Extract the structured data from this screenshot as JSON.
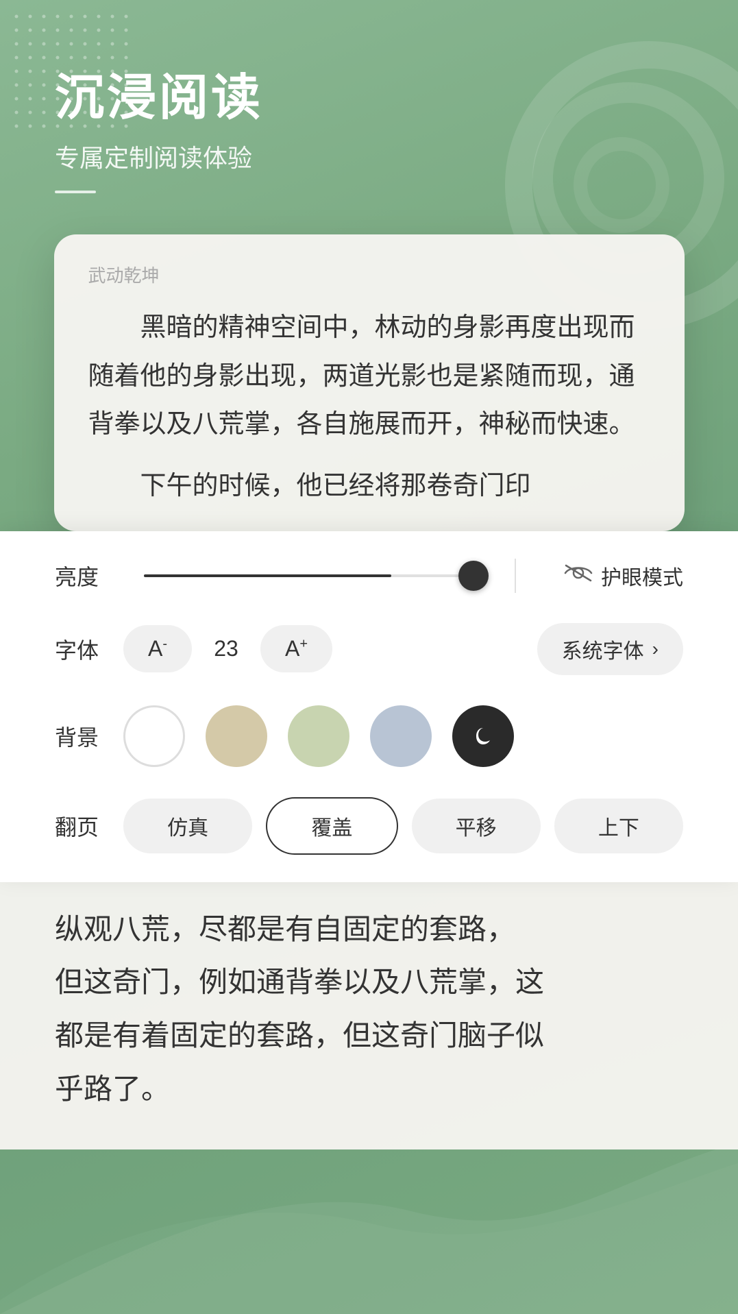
{
  "hero": {
    "title": "沉浸阅读",
    "subtitle": "专属定制阅读体验"
  },
  "reading": {
    "book_title": "武动乾坤",
    "paragraph1": "黑暗的精神空间中，林动的身影再度出现而随着他的身影出现，两道光影也是紧随而现，通背拳以及八荒掌，各自施展而开，神秘而快速。",
    "paragraph2": "下午的时候，他已经将那卷奇门印",
    "bottom_text_1": "纵观八荒，尽都是有自固定的套路，",
    "bottom_text_2": "但这奇门，例如通背拳以及八荒掌，这",
    "bottom_text_3": "都是有着固定的套路，但这奇门脑子似",
    "bottom_text_4": "乎路了。"
  },
  "settings": {
    "brightness_label": "亮度",
    "brightness_value": 75,
    "eye_mode_label": "护眼模式",
    "font_label": "字体",
    "font_size": "23",
    "font_decrease": "A⁻",
    "font_increase": "A⁺",
    "font_family": "系统字体",
    "font_family_arrow": "›",
    "bg_label": "背景",
    "backgrounds": [
      {
        "name": "white",
        "color": "#ffffff"
      },
      {
        "name": "beige",
        "color": "#d4c9a8"
      },
      {
        "name": "light-green",
        "color": "#c8d4b0"
      },
      {
        "name": "light-blue",
        "color": "#b8c4d4"
      },
      {
        "name": "dark",
        "color": "#2a2a2a"
      }
    ],
    "pageturn_label": "翻页",
    "pageturn_options": [
      "仿真",
      "覆盖",
      "平移",
      "上下"
    ],
    "pageturn_active": "覆盖"
  }
}
